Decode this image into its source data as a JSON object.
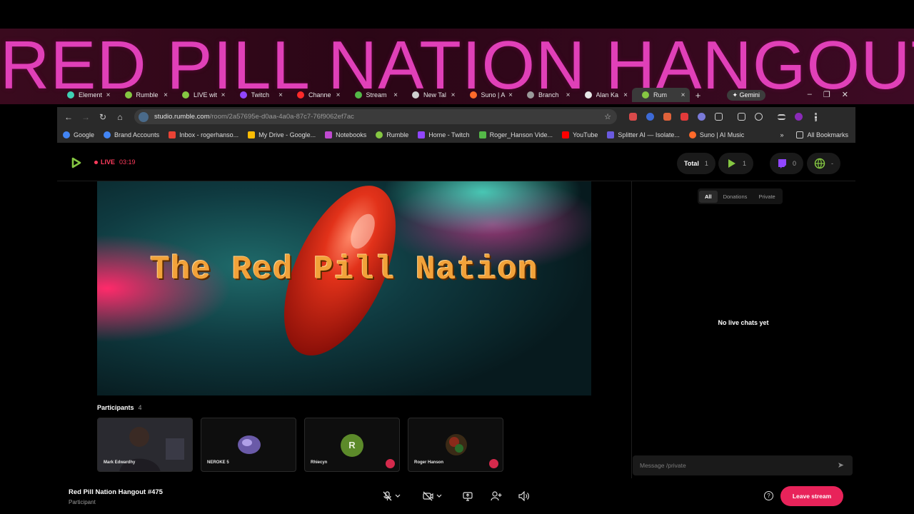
{
  "overlay": {
    "banner_title": "RED PILL NATION HANGOUT"
  },
  "browser": {
    "tabs": [
      {
        "label": "Element",
        "color": "#3fd0b4"
      },
      {
        "label": "Rumble",
        "color": "#85c742"
      },
      {
        "label": "LIVE wit",
        "color": "#85c742"
      },
      {
        "label": "Twitch",
        "color": "#9146ff"
      },
      {
        "label": "Channe",
        "color": "#ff2a2a"
      },
      {
        "label": "Stream",
        "color": "#54b848"
      },
      {
        "label": "New Tal",
        "color": "#cfcfcf"
      },
      {
        "label": "Suno | A",
        "color": "#ff6a2a"
      },
      {
        "label": "Branch",
        "color": "#9a9a9a"
      },
      {
        "label": "Alan Ka",
        "color": "#e6e6e6"
      },
      {
        "label": "Rum",
        "color": "#85c742"
      }
    ],
    "new_tab": "+",
    "gemini_label": "✦ Gemini",
    "address": {
      "host": "studio.rumble.com",
      "path": "/room/2a57695e-d0aa-4a0a-87c7-76f9062ef7ac"
    },
    "bookmarks": [
      {
        "label": "Google",
        "color": "#4285f4"
      },
      {
        "label": "Brand Accounts",
        "color": "#4285f4"
      },
      {
        "label": "Inbox - rogerhanso...",
        "color": "#ea4335"
      },
      {
        "label": "My Drive - Google...",
        "color": "#fbbc04"
      },
      {
        "label": "Notebooks",
        "color": "#c04ad0"
      },
      {
        "label": "Rumble",
        "color": "#85c742"
      },
      {
        "label": "Home - Twitch",
        "color": "#9146ff"
      },
      {
        "label": "Roger_Hanson Vide...",
        "color": "#54b848"
      },
      {
        "label": "YouTube",
        "color": "#ff0000"
      },
      {
        "label": "Splitter AI — Isolate...",
        "color": "#6a5adf"
      },
      {
        "label": "Suno | AI Music",
        "color": "#ff6a2a"
      }
    ],
    "bookmarks_more": "»",
    "all_bookmarks": "All Bookmarks"
  },
  "studio": {
    "live_label": "LIVE",
    "live_time": "03:19",
    "stats": {
      "total_label": "Total",
      "total": "1",
      "rumble": "1",
      "twitch": "0",
      "web": "-"
    },
    "stage_title": "The Red Pill Nation",
    "participants_label": "Participants",
    "participants_count": "4",
    "participants": [
      {
        "name": "Mark Edwardhy"
      },
      {
        "name": "NEROKE 5"
      },
      {
        "name": "Rhiecyn",
        "avatar_letter": "R"
      },
      {
        "name": "Roger Hanson"
      }
    ],
    "chat": {
      "tabs": [
        "All",
        "Donations",
        "Private"
      ],
      "empty_text": "No live chats yet",
      "input_placeholder": "Message /private"
    },
    "session": {
      "title": "Red Pill Nation Hangout #475",
      "role": "Participant"
    },
    "leave_label": "Leave stream",
    "help_label": "?"
  },
  "colors": {
    "accent": "#e8235a",
    "live": "#ff3b5c",
    "rumble_green": "#85c742",
    "banner_text": "#e040b8"
  }
}
